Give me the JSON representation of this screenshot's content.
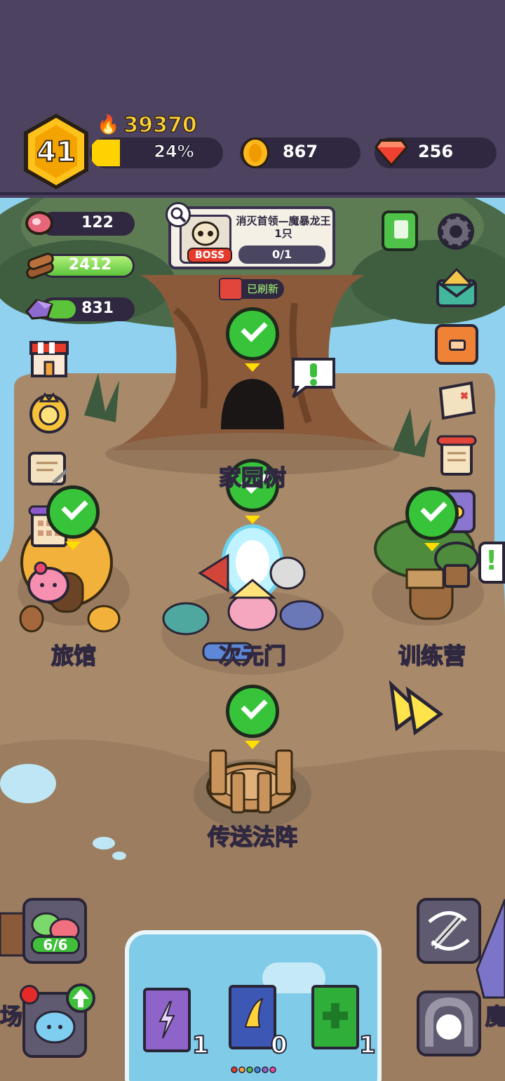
{
  "header": {
    "level": "41",
    "power": "39370",
    "exp_percent_label": "24%",
    "exp_fraction": 0.24,
    "coins": "867",
    "gems": "256"
  },
  "resources": {
    "meat": "122",
    "wood": "2412",
    "ore": "831"
  },
  "boss_quest": {
    "badge": "BOSS",
    "title": "消灭首领—魔暴龙王1只",
    "progress": "0/1"
  },
  "refresh_tag": "已刷新",
  "locations": {
    "home_tree": "家园树",
    "inn": "旅馆",
    "portal": "次元门",
    "training_camp": "训练营",
    "teleport_circle": "传送法阵",
    "left_edge": "场",
    "right_edge": "魔"
  },
  "squad": {
    "count": "6/6"
  },
  "books": [
    {
      "color": "purple",
      "count": "1"
    },
    {
      "color": "blue",
      "count": "0"
    },
    {
      "color": "green",
      "count": "1"
    }
  ],
  "colors": {
    "top_bar": "#4d4361",
    "exp_fill": "#ffd200",
    "check_green": "#38c43a",
    "ground": "#a98a6c"
  },
  "icons": [
    "flame-icon",
    "coin-icon",
    "gem-icon",
    "meat-icon",
    "wood-icon",
    "ore-icon",
    "shop-icon",
    "crown-badge-icon",
    "scroll-icon",
    "calendar-icon",
    "pink-pet-icon",
    "quest-book-icon",
    "gear-icon",
    "mail-icon",
    "backpack-icon",
    "map-icon",
    "notice-scroll-icon",
    "potion-icon",
    "tree-house-icon",
    "fast-forward-icon",
    "sword-swap-icon",
    "portal-stone-icon"
  ]
}
